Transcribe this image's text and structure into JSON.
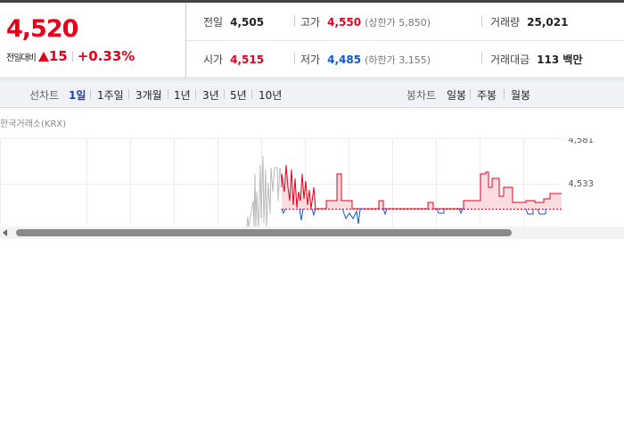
{
  "quote": {
    "price": "4,520",
    "change_label": "전일대비",
    "change_value": "15",
    "change_pct": "+0.33%",
    "stats": {
      "prev_close": {
        "label": "전일",
        "value": "4,505"
      },
      "high": {
        "label": "고가",
        "value": "4,550",
        "sub": "(상한가 5,850)"
      },
      "volume": {
        "label": "거래량",
        "value": "25,021"
      },
      "open": {
        "label": "시가",
        "value": "4,515"
      },
      "low": {
        "label": "저가",
        "value": "4,485",
        "sub": "(하한가 3,155)"
      },
      "trade_amount": {
        "label": "거래대금",
        "value": "113 백만"
      }
    }
  },
  "tabs": {
    "line_title": "선차트",
    "line_tabs": [
      "1일",
      "1주일",
      "3개월",
      "1년",
      "3년",
      "5년",
      "10년"
    ],
    "active_line_tab": "1일",
    "candle_title": "봉차트",
    "candle_tabs": [
      "일봉",
      "주봉",
      "월봉"
    ]
  },
  "exchange_label": "한국거래소(KRX)",
  "chart_data": {
    "type": "line",
    "y_ticks": [
      "4,581",
      "4,533"
    ],
    "baseline": 4505,
    "colors": {
      "up": "#e4001b",
      "down": "#1257d2",
      "pre": "#bbbbbb"
    }
  }
}
